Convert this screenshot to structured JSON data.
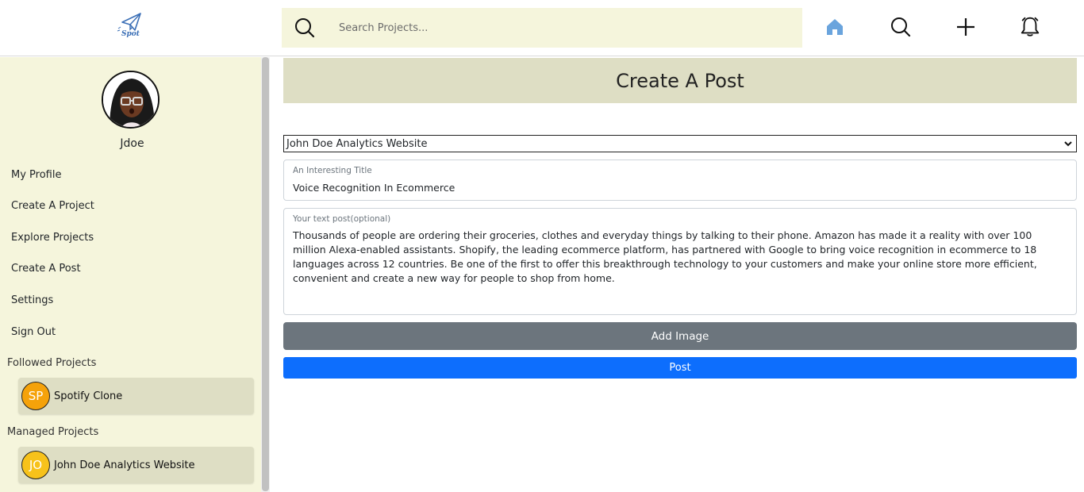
{
  "header": {
    "logo_text": "Spot",
    "search": {
      "placeholder": "Search Projects..."
    },
    "nav_icons": [
      "home-icon",
      "search-icon",
      "plus-icon",
      "bell-icon"
    ],
    "home_icon_color": "#6aa4dd"
  },
  "sidebar": {
    "username": "Jdoe",
    "menu": [
      {
        "label": "My Profile"
      },
      {
        "label": "Create A Project"
      },
      {
        "label": "Explore Projects"
      },
      {
        "label": "Create A Post"
      },
      {
        "label": "Settings"
      },
      {
        "label": "Sign Out"
      }
    ],
    "followed_label": "Followed Projects",
    "followed": [
      {
        "initials": "SP",
        "name": "Spotify Clone",
        "color": "#f5a20a"
      }
    ],
    "managed_label": "Managed Projects",
    "managed": [
      {
        "initials": "JO",
        "name": "John Doe Analytics Website",
        "color": "#f7c21b"
      }
    ]
  },
  "main": {
    "title": "Create A Post",
    "project_select": {
      "selected": "John Doe Analytics Website"
    },
    "title_field": {
      "label": "An Interesting Title",
      "value": "Voice Recognition In Ecommerce"
    },
    "text_field": {
      "label": "Your text post(optional)",
      "value": "Thousands of people are ordering their groceries, clothes and everyday things by talking to their phone. Amazon has made it a reality with over 100 million Alexa-enabled assistants. Shopify, the leading ecommerce platform, has partnered with Google to bring voice recognition in ecommerce to 18 languages across 12 countries. Be one of the first to offer this breakthrough technology to your customers and make your online store more efficient, convenient and create a new way for people to shop from home."
    },
    "add_image_label": "Add Image",
    "post_label": "Post"
  },
  "colors": {
    "sidebar_bg": "#f5f5dc",
    "card_bg": "#dedec4",
    "post_button": "#0d6efd",
    "image_button": "#6c757d"
  }
}
